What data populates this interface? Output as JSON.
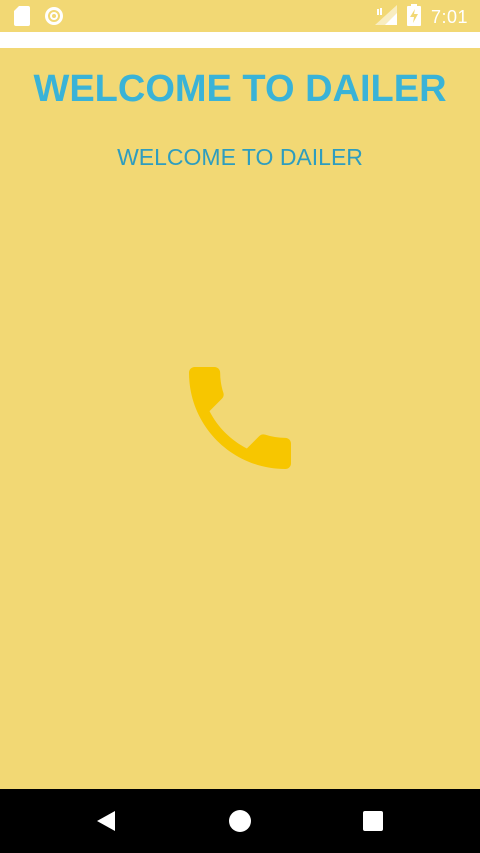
{
  "status_bar": {
    "time": "7:01",
    "icons": [
      "sd-card-icon",
      "sync-icon",
      "signal-icon",
      "battery-charging-icon"
    ]
  },
  "main": {
    "title": "WELCOME TO DAILER",
    "subtitle": "WELCOME TO DAILER",
    "center_icon": "phone-icon"
  },
  "nav_bar": {
    "buttons": [
      "back-icon",
      "home-icon",
      "recents-icon"
    ]
  },
  "colors": {
    "background": "#f2d874",
    "title": "#3ab3d7",
    "subtitle": "#2e9dbf",
    "phone_icon": "#f7c600",
    "nav_bar": "#000000"
  }
}
